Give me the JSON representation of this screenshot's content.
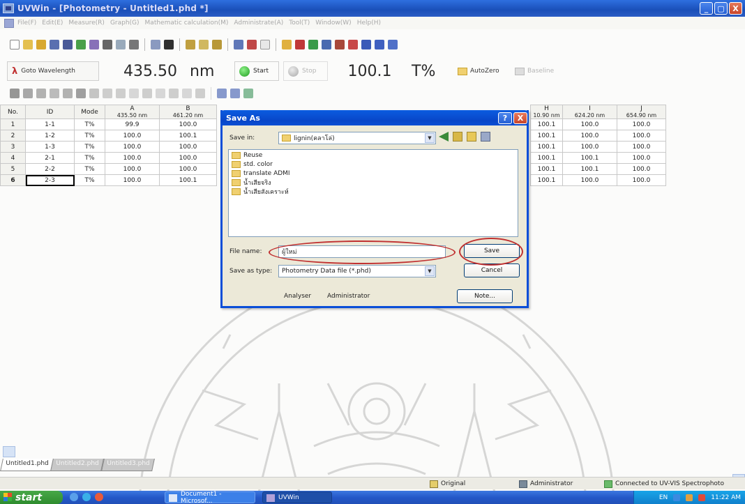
{
  "titlebar": {
    "title": "UVWin - [Photometry - Untitled1.phd *]",
    "min": "_",
    "max": "▢",
    "close": "X"
  },
  "menu": [
    "File(F)",
    "Edit(E)",
    "Measure(R)",
    "Graph(G)",
    "Mathematic calculation(M)",
    "Administrate(A)",
    "Tool(T)",
    "Window(W)",
    "Help(H)"
  ],
  "controls": {
    "goto_label": "Goto Wavelength",
    "wavelength": "435.50",
    "wavelength_unit": "nm",
    "start": "Start",
    "stop": "Stop",
    "reading": "100.1",
    "reading_unit": "T%",
    "autozero": "AutoZero",
    "baseline": "Baseline"
  },
  "grid": {
    "headers": [
      "No.",
      "ID",
      "Mode",
      "A",
      "B"
    ],
    "subheaders": [
      "",
      "",
      "",
      "435.50 nm",
      "461.20 nm"
    ],
    "rows": [
      [
        "1",
        "1-1",
        "T%",
        "99.9",
        "100.0"
      ],
      [
        "2",
        "1-2",
        "T%",
        "100.0",
        "100.1"
      ],
      [
        "3",
        "1-3",
        "T%",
        "100.0",
        "100.0"
      ],
      [
        "4",
        "2-1",
        "T%",
        "100.0",
        "100.0"
      ],
      [
        "5",
        "2-2",
        "T%",
        "100.0",
        "100.0"
      ],
      [
        "6",
        "2-3",
        "T%",
        "100.0",
        "100.1"
      ]
    ]
  },
  "grid_right": {
    "headers": [
      "H",
      "I",
      "J"
    ],
    "subheaders": [
      "10.90 nm",
      "624.20 nm",
      "654.90 nm"
    ],
    "rows": [
      [
        "100.1",
        "100.0",
        "100.0"
      ],
      [
        "100.1",
        "100.0",
        "100.0"
      ],
      [
        "100.1",
        "100.0",
        "100.0"
      ],
      [
        "100.1",
        "100.1",
        "100.0"
      ],
      [
        "100.1",
        "100.1",
        "100.0"
      ],
      [
        "100.1",
        "100.0",
        "100.0"
      ]
    ]
  },
  "dialog": {
    "title": "Save As",
    "help": "?",
    "close": "X",
    "save_in_label": "Save in:",
    "save_in_value": "lignin(คลาโล่)",
    "folders": [
      "Reuse",
      "std. color",
      "translate ADMI",
      "น้ำเสียจริง",
      "น้ำเสียสังเคราะห์"
    ],
    "file_name_label": "File name:",
    "file_name_value": "ผู้ใหม่",
    "save_as_type_label": "Save as type:",
    "save_as_type_value": "Photometry Data file (*.phd)",
    "save_button": "Save",
    "cancel_button": "Cancel",
    "analyser_label": "Analyser",
    "analyser_value": "Administrator",
    "note_button": "Note..."
  },
  "tabs": [
    "Untitled1.phd",
    "Untitled2.phd",
    "Untitled3.phd"
  ],
  "statusbar": {
    "original": "Original",
    "user": "Administrator",
    "connection": "Connected to UV-VIS Spectrophoto"
  },
  "taskbar": {
    "start": "start",
    "tasks": [
      "Document1 - Microsof...",
      "UVWin"
    ],
    "lang": "EN",
    "time": "11:22 AM"
  },
  "colors": {
    "accent": "#0a4ed8",
    "highlight_ellipse": "#c03030",
    "start_green": "#1e9b1e"
  }
}
